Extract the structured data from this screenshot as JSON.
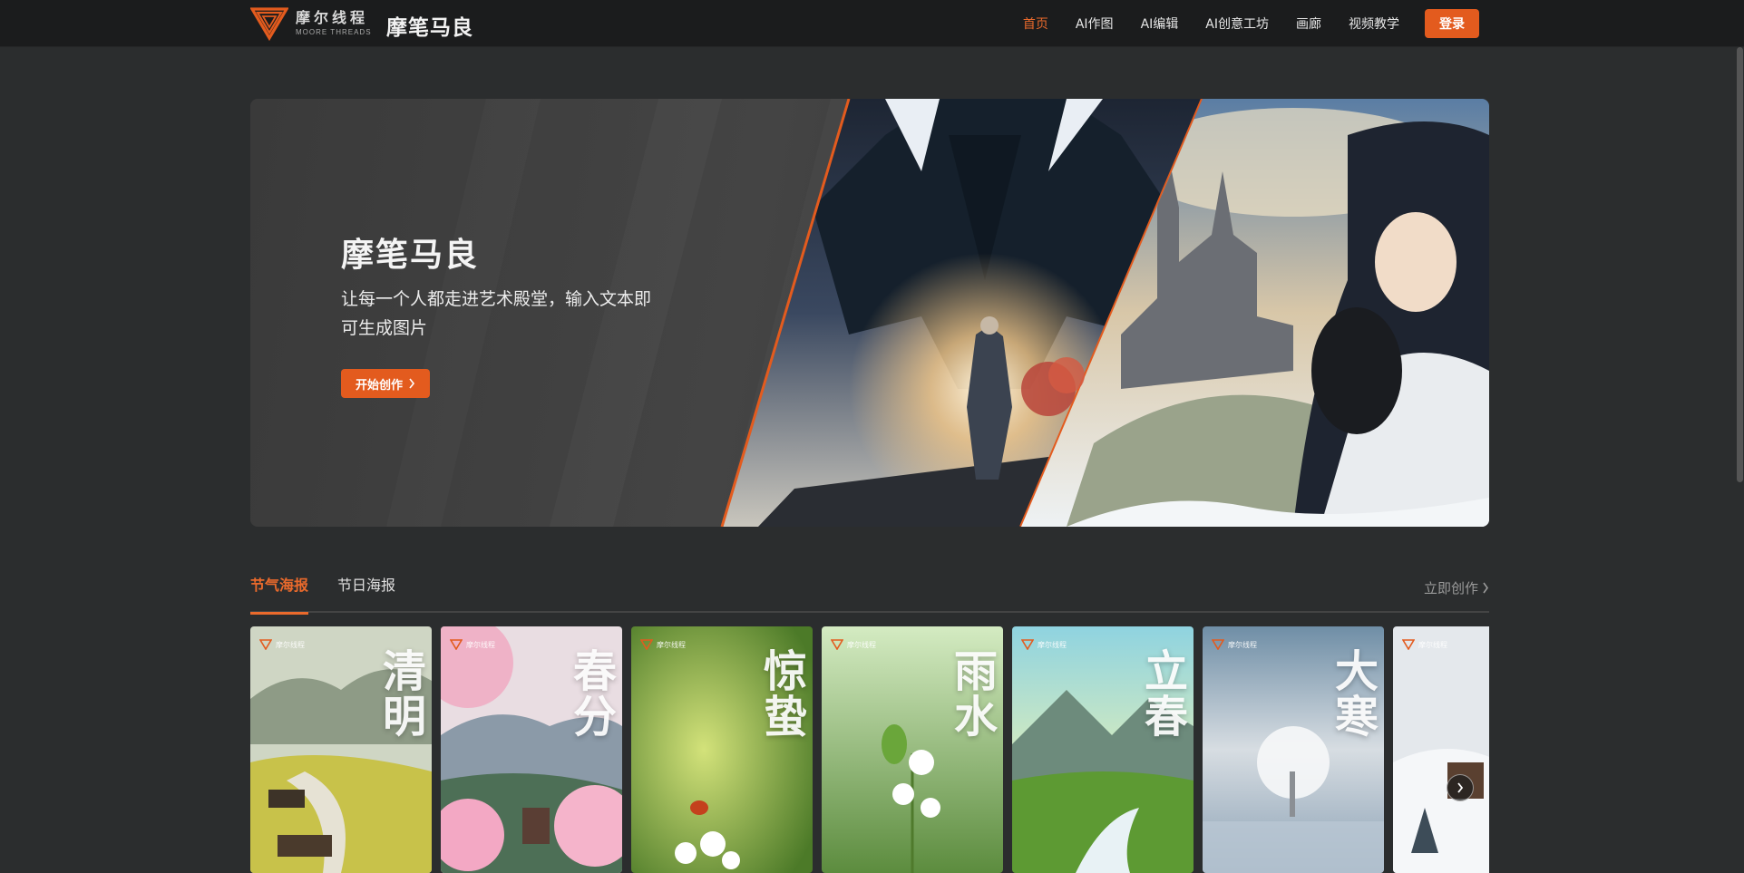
{
  "header": {
    "logo": {
      "cn": "摩尔线程",
      "en": "MOORE THREADS",
      "icon": "moore-threads-triangle-logo"
    },
    "brand_name": "摩笔马良",
    "nav": [
      {
        "label": "首页",
        "active": true
      },
      {
        "label": "AI作图",
        "active": false
      },
      {
        "label": "AI编辑",
        "active": false
      },
      {
        "label": "AI创意工坊",
        "active": false
      },
      {
        "label": "画廊",
        "active": false
      },
      {
        "label": "视频教学",
        "active": false
      }
    ],
    "login_label": "登录"
  },
  "hero": {
    "title": "摩笔马良",
    "description": "让每一个人都走进艺术殿堂，输入文本即可生成图片",
    "button_label": "开始创作",
    "button_icon": "chevron-right-icon"
  },
  "section": {
    "tabs": [
      {
        "label": "节气海报",
        "active": true
      },
      {
        "label": "节日海报",
        "active": false
      }
    ],
    "create_link": "立即创作",
    "create_link_icon": "chevron-right-icon"
  },
  "posters": [
    {
      "title": "清明",
      "logo": "摩尔线程"
    },
    {
      "title": "春分",
      "logo": "摩尔线程"
    },
    {
      "title": "惊蛰",
      "logo": "摩尔线程"
    },
    {
      "title": "雨水",
      "logo": "摩尔线程"
    },
    {
      "title": "立春",
      "logo": "摩尔线程"
    },
    {
      "title": "大寒",
      "logo": "摩尔线程"
    },
    {
      "title": "",
      "logo": "摩尔线程"
    }
  ],
  "colors": {
    "accent": "#e35b1e",
    "accent_text": "#ea6a2c",
    "background": "#2b2d2e",
    "header_bg": "#1b1c1d"
  }
}
